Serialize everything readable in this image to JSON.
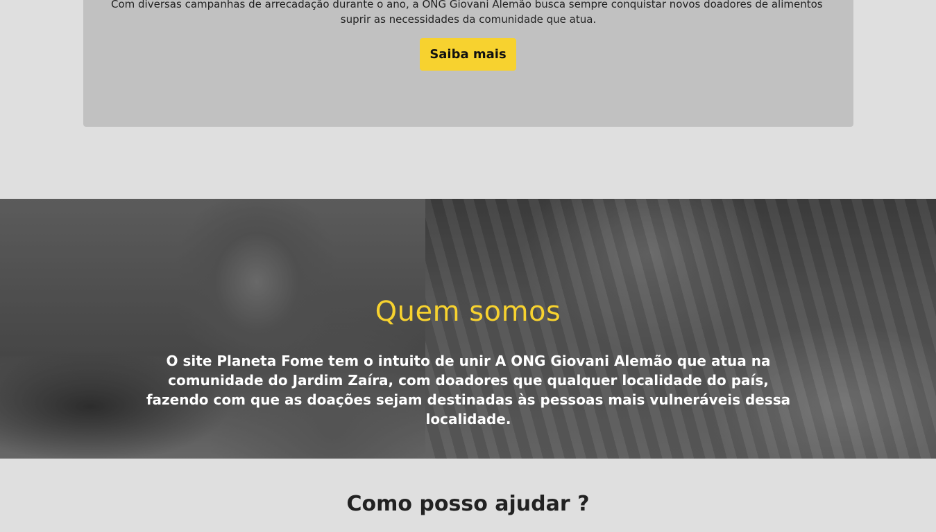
{
  "info_card": {
    "text_line1": "Com diversas campanhas de arrecadação durante o ano, a ONG Giovani Alemão busca sempre conquistar novos doadores de alimentos para",
    "text_line2": "suprir as necessidades da comunidade que atua.",
    "button_label": "Saiba mais"
  },
  "about": {
    "title": "Quem somos",
    "text": "O site Planeta Fome tem o intuito de unir A ONG Giovani Alemão que atua na comunidade do Jardim Zaíra, com doadores que qualquer localidade do país, fazendo com que as doações sejam destinadas às pessoas mais vulneráveis dessa localidade."
  },
  "help": {
    "title": "Como posso ajudar ?"
  },
  "colors": {
    "accent": "#f7d22f",
    "background": "#dfdfdf",
    "card": "#c1c1c1"
  }
}
